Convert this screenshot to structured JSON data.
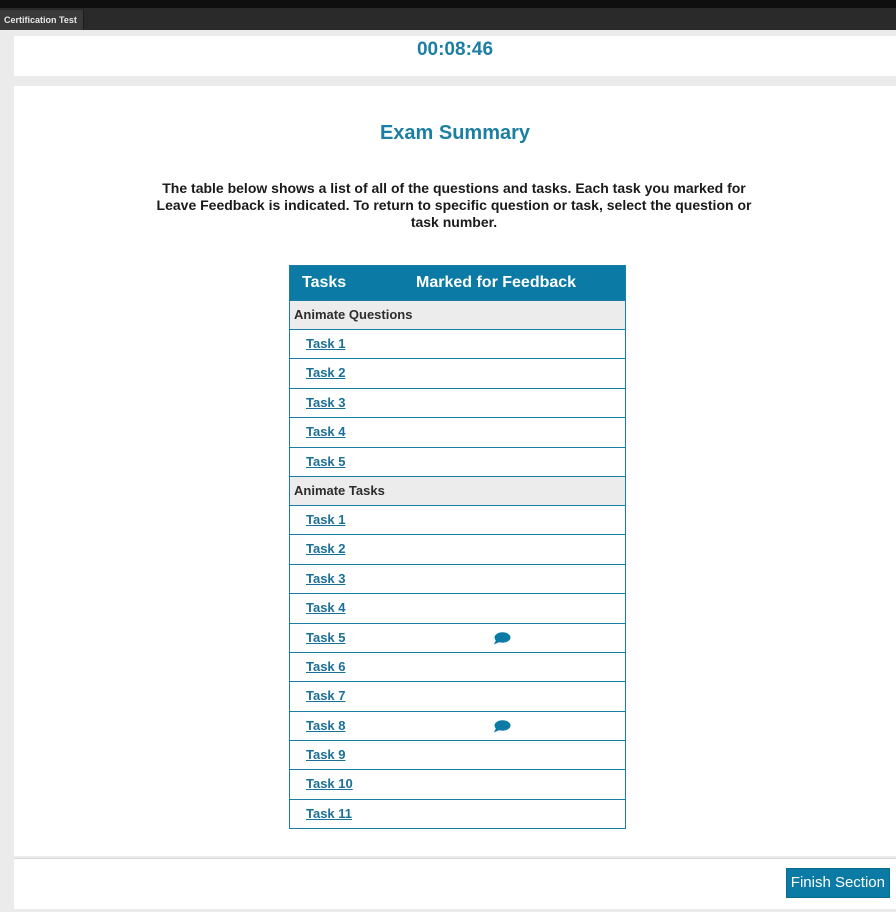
{
  "window": {
    "tab_title": "Certification Test"
  },
  "timer": {
    "value": "00:08:46"
  },
  "summary": {
    "title": "Exam Summary",
    "instructions": "The table below shows a list of all of the questions and tasks. Each task you marked for Leave Feedback is indicated. To return to specific question or task, select the question or task number."
  },
  "table": {
    "header_tasks": "Tasks",
    "header_feedback": "Marked for Feedback",
    "groups": [
      {
        "label": "Animate Questions",
        "tasks": [
          {
            "label": "Task 1",
            "feedback": false
          },
          {
            "label": "Task 2",
            "feedback": false
          },
          {
            "label": "Task 3",
            "feedback": false
          },
          {
            "label": "Task 4",
            "feedback": false
          },
          {
            "label": "Task 5",
            "feedback": false
          }
        ]
      },
      {
        "label": "Animate Tasks",
        "tasks": [
          {
            "label": "Task 1",
            "feedback": false
          },
          {
            "label": "Task 2",
            "feedback": false
          },
          {
            "label": "Task 3",
            "feedback": false
          },
          {
            "label": "Task 4",
            "feedback": false
          },
          {
            "label": "Task 5",
            "feedback": true
          },
          {
            "label": "Task 6",
            "feedback": false
          },
          {
            "label": "Task 7",
            "feedback": false
          },
          {
            "label": "Task 8",
            "feedback": true
          },
          {
            "label": "Task 9",
            "feedback": false
          },
          {
            "label": "Task 10",
            "feedback": false
          },
          {
            "label": "Task 11",
            "feedback": false
          }
        ]
      }
    ]
  },
  "footer": {
    "finish_label": "Finish Section"
  },
  "colors": {
    "accent": "#0b7aa5",
    "title_text": "#1d7ea3",
    "link": "#1a6f96"
  },
  "icons": {
    "feedback": "speech-bubble-icon"
  }
}
